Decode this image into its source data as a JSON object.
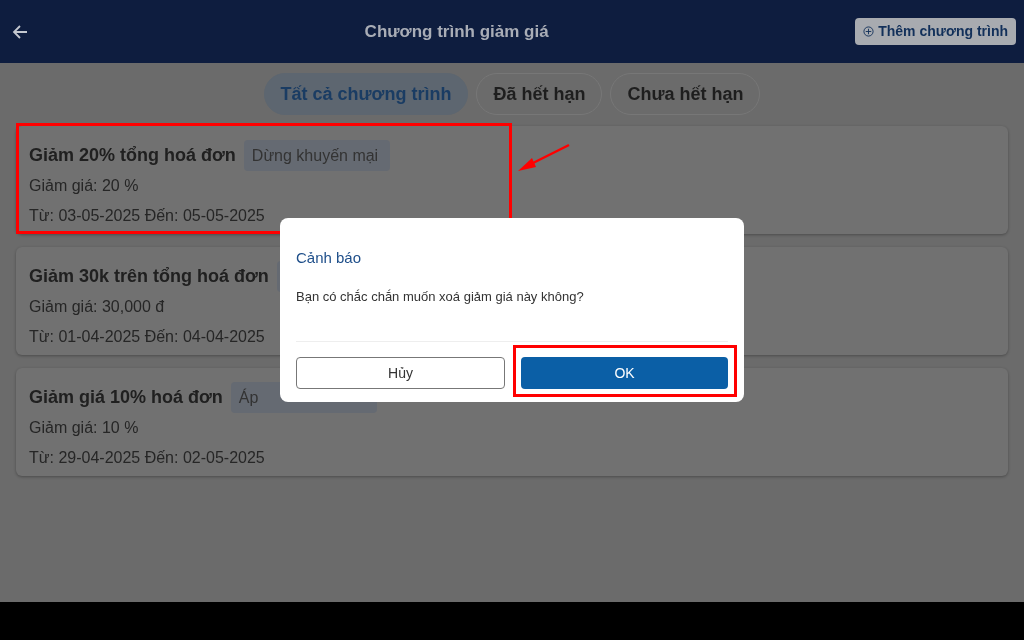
{
  "header": {
    "title": "Chương trình giảm giá",
    "add_button": "Thêm chương trình"
  },
  "tabs": [
    {
      "label": "Tất cả chương trình",
      "selected": true
    },
    {
      "label": "Đã hết hạn",
      "selected": false
    },
    {
      "label": "Chưa hết hạn",
      "selected": false
    }
  ],
  "cards": [
    {
      "title": "Giảm 20% tổng hoá đơn",
      "badge": "Dừng khuyến mại",
      "discount": "Giảm giá: 20 %",
      "period": "Từ: 03-05-2025 Đến: 05-05-2025",
      "highlighted": true
    },
    {
      "title": "Giảm 30k trên tổng hoá đơn",
      "has_badge": true,
      "discount": "Giảm giá: 30,000 đ",
      "period": "Từ: 01-04-2025 Đến: 04-04-2025",
      "highlighted": false
    },
    {
      "title": "Giảm giá 10% hoá đơn",
      "badge": "Áp",
      "discount": "Giảm giá: 10 %",
      "period": "Từ: 29-04-2025 Đến: 02-05-2025",
      "highlighted": false
    }
  ],
  "dialog": {
    "title": "Cảnh báo",
    "message": "Bạn có chắc chắn muốn xoá giảm giá này không?",
    "cancel": "Hủy",
    "ok": "OK",
    "ok_highlighted": true
  }
}
